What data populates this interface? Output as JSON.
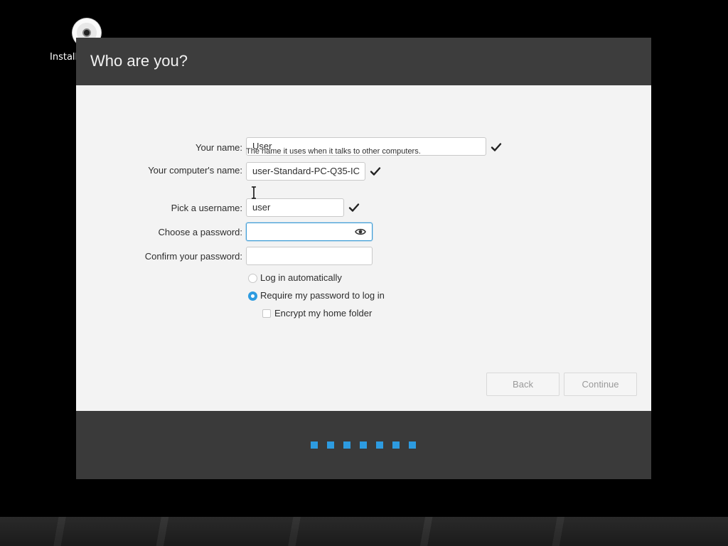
{
  "desktop": {
    "icon_label": "Install"
  },
  "window": {
    "title": "Who are you?"
  },
  "form": {
    "your_name_label": "Your name:",
    "your_name_value": "User",
    "computer_name_label": "Your computer's name:",
    "computer_name_value": "user-Standard-PC-Q35-IC",
    "computer_name_hint": "The name it uses when it talks to other computers.",
    "username_label": "Pick a username:",
    "username_value": "user",
    "password_label": "Choose a password:",
    "password_value": "",
    "confirm_password_label": "Confirm your password:",
    "confirm_password_value": ""
  },
  "options": {
    "log_in_automatically": "Log in automatically",
    "require_password": "Require my password to log in",
    "encrypt_home": "Encrypt my home folder",
    "selected": "require_password",
    "encrypt_checked": false
  },
  "buttons": {
    "back": "Back",
    "continue": "Continue"
  },
  "progress": {
    "steps": 7
  },
  "colors": {
    "accent": "#2d9be0",
    "header": "#3d3d3d",
    "footer": "#3a3a3a"
  },
  "icons": {
    "check": "checkmark-icon",
    "reveal": "eye-icon",
    "disc": "optical-disc-icon"
  }
}
